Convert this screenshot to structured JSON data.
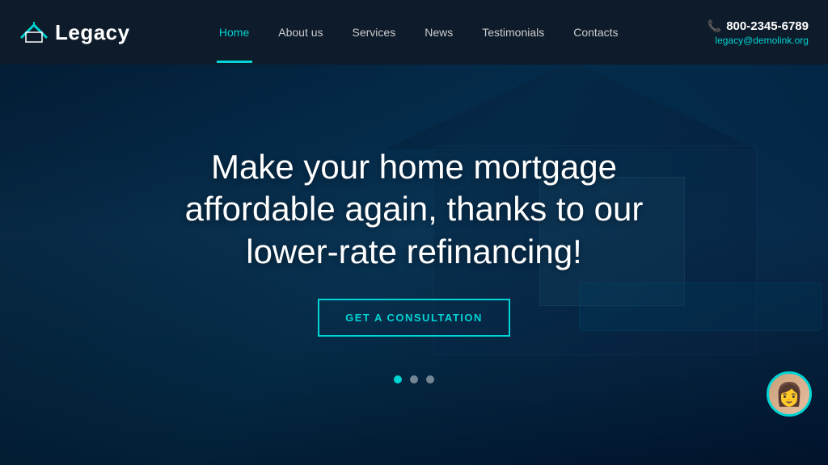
{
  "logo": {
    "text": "Legacy"
  },
  "nav": {
    "items": [
      {
        "label": "Home",
        "active": true
      },
      {
        "label": "About us",
        "active": false
      },
      {
        "label": "Services",
        "active": false
      },
      {
        "label": "News",
        "active": false
      },
      {
        "label": "Testimonials",
        "active": false
      },
      {
        "label": "Contacts",
        "active": false
      }
    ]
  },
  "contact": {
    "phone": "800-2345-6789",
    "email": "legacy@demolink.org"
  },
  "hero": {
    "heading": "Make your home mortgage affordable again, thanks to our lower-rate refinancing!",
    "cta_label": "GET A CONSULTATION"
  },
  "slider": {
    "active_dot": 0,
    "total_dots": 3
  }
}
